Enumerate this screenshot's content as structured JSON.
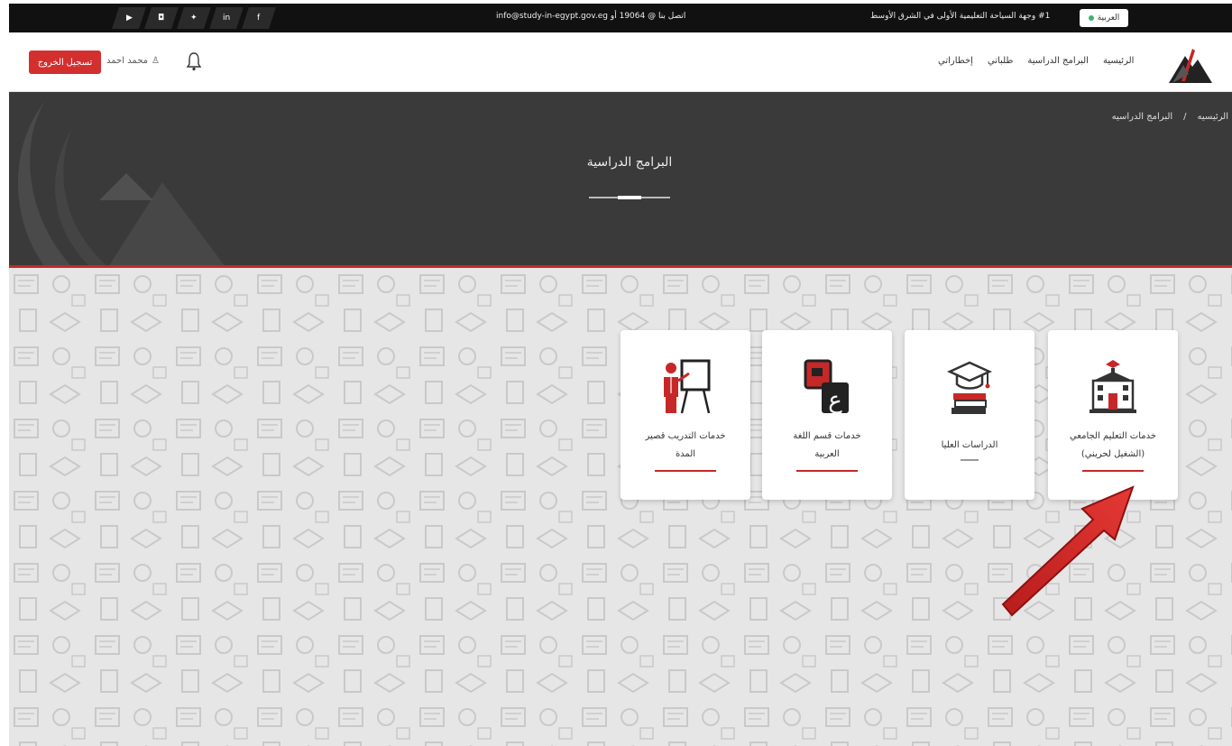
{
  "topbar": {
    "social_icons": [
      "youtube-icon",
      "instagram-icon",
      "twitter-icon",
      "linkedin-icon",
      "facebook-icon"
    ],
    "contact_text": "اتصل بنا @ 19064 أو info@study-in-egypt.gov.eg",
    "tagline": "#1 وجهة السياحة التعليمية الأولى في الشرق الأوسط",
    "lang_label": "العربية"
  },
  "header": {
    "logout_label": "تسجيل الخروج",
    "user_name": "محمد احمد",
    "nav": [
      "الرئيسية",
      "البرامج الدراسية",
      "طلباتي",
      "إخطاراتي"
    ]
  },
  "hero": {
    "title": "البرامج الدراسية",
    "breadcrumb": [
      "الرئيسيه",
      "/",
      "البرامج الدراسيه"
    ]
  },
  "cards": [
    {
      "label_line1": "خدمات التعليم الجامعي",
      "label_line2": "(الشغيل لحريني)",
      "icon": "university-building-icon"
    },
    {
      "label_line1": "الدراسات العليا",
      "label_line2": "",
      "icon": "graduation-cap-books-icon"
    },
    {
      "label_line1": "خدمات قسم اللغة",
      "label_line2": "العربية",
      "icon": "arabic-letter-icon"
    },
    {
      "label_line1": "خدمات التدريب قصير",
      "label_line2": "المدة",
      "icon": "presenter-board-icon"
    }
  ],
  "colors": {
    "accent": "#c62828",
    "topbar": "#111111",
    "hero": "#3a3a3a",
    "pattern": "#e6e6e6"
  }
}
